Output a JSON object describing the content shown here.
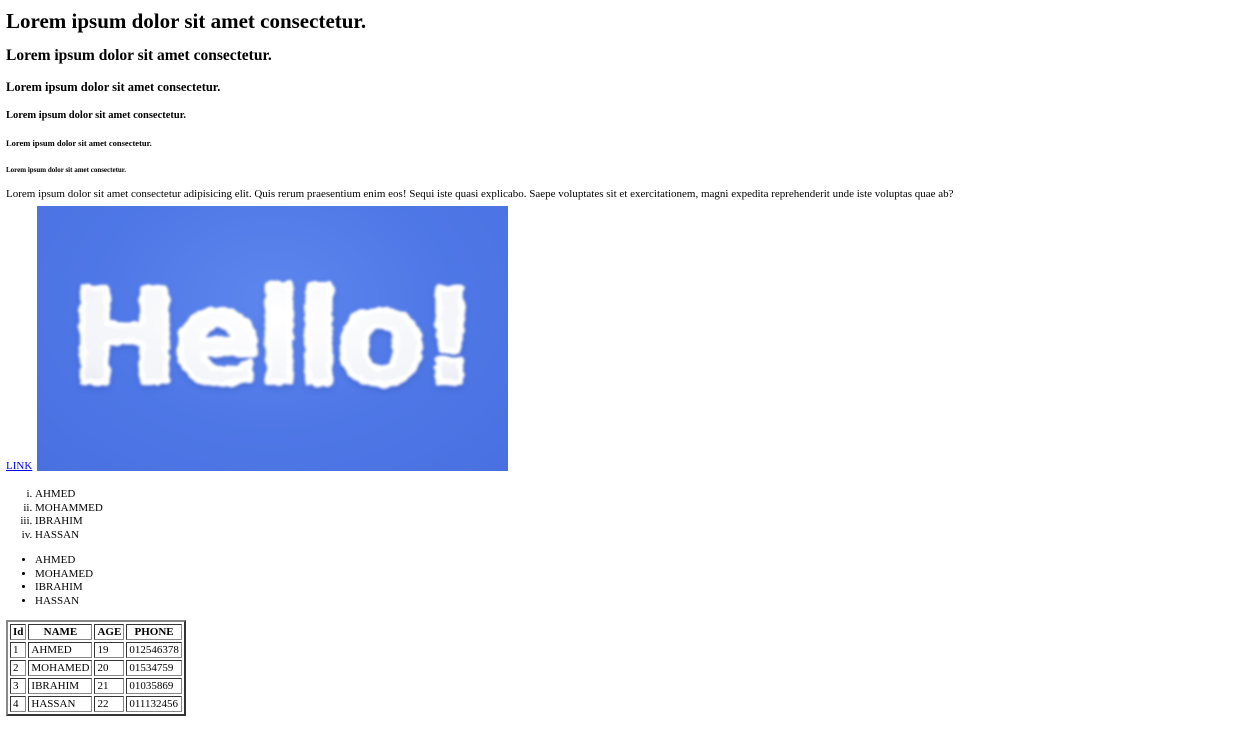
{
  "headings": {
    "h1": "Lorem ipsum dolor sit amet consectetur.",
    "h2": "Lorem ipsum dolor sit amet consectetur.",
    "h3": "Lorem ipsum dolor sit amet consectetur.",
    "h4": "Lorem ipsum dolor sit amet consectetur.",
    "h5": "Lorem ipsum dolor sit amet consectetur.",
    "h6": "Lorem ipsum dolor sit amet consectetur."
  },
  "paragraph": "Lorem ipsum dolor sit amet consectetur adipisicing elit. Quis rerum praesentium enim eos! Sequi iste quasi explicabo. Saepe voluptates sit et exercitationem, magni expedita reprehenderit unde iste voluptas quae ab?",
  "link": {
    "label": "LINK"
  },
  "image": {
    "word": "Hello!",
    "background": "#5079e6"
  },
  "ordered_list": [
    "AHMED",
    "MOHAMMED",
    "IBRAHIM",
    "HASSAN"
  ],
  "unordered_list": [
    "AHMED",
    "MOHAMED",
    "IBRAHIM",
    "HASSAN"
  ],
  "table": {
    "headers": [
      "Id",
      "NAME",
      "AGE",
      "PHONE"
    ],
    "rows": [
      [
        "1",
        "AHMED",
        "19",
        "012546378"
      ],
      [
        "2",
        "MOHAMED",
        "20",
        "01534759"
      ],
      [
        "3",
        "IBRAHIM",
        "21",
        "01035869"
      ],
      [
        "4",
        "HASSAN",
        "22",
        "011132456"
      ]
    ]
  }
}
